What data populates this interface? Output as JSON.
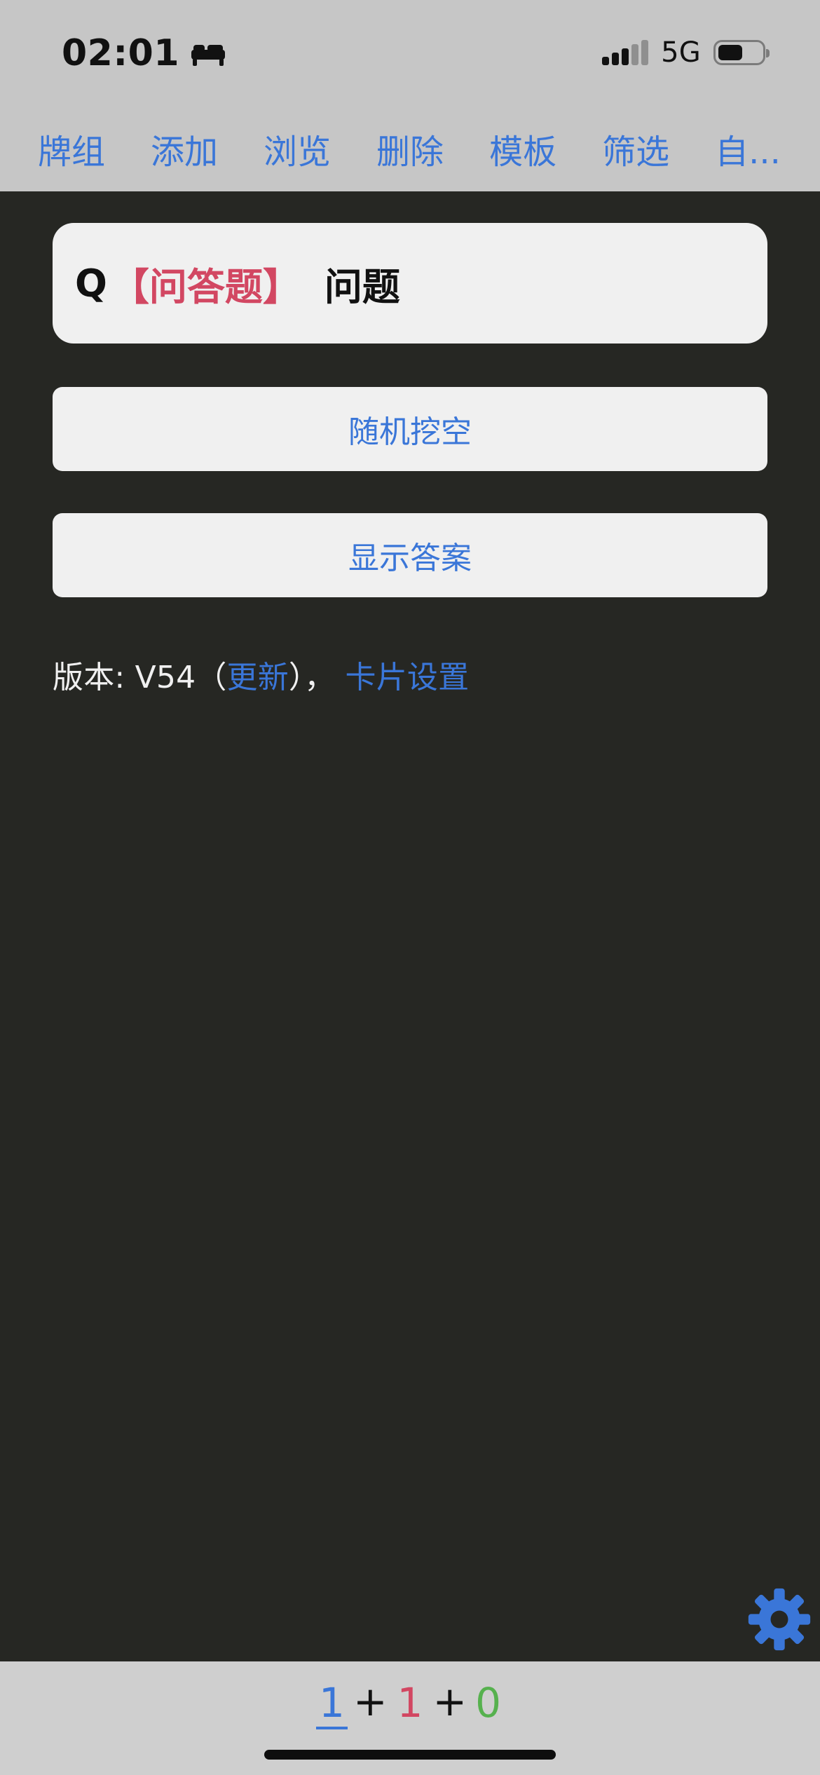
{
  "status_bar": {
    "time": "02:01",
    "sleep_icon": "bed-icon",
    "network": "5G",
    "signal_icon": "signal-icon",
    "battery_icon": "battery-icon",
    "battery_level_percent": 50
  },
  "toolbar": {
    "items": [
      {
        "label": "牌组"
      },
      {
        "label": "添加"
      },
      {
        "label": "浏览"
      },
      {
        "label": "删除"
      },
      {
        "label": "模板"
      },
      {
        "label": "筛选"
      },
      {
        "label": "自..."
      }
    ]
  },
  "card": {
    "question_prefix": "Q",
    "question_tag": "【问答题】",
    "question_text": "问题"
  },
  "buttons": {
    "random_cloze": "随机挖空",
    "show_answer": "显示答案"
  },
  "version": {
    "label": "版本: V54",
    "open_paren": "（",
    "update_link": "更新",
    "close_paren": "）",
    "separator": "，",
    "card_settings_link": "卡片设置"
  },
  "floating": {
    "settings_icon": "gear-icon"
  },
  "counts": {
    "new": "1",
    "learn": "1",
    "review": "0",
    "plus": "+"
  },
  "colors": {
    "accent_blue": "#3a76d8",
    "accent_red": "#d24762",
    "accent_green": "#56b14e",
    "app_background": "#262723",
    "toolbar_background": "#c6c6c6",
    "bottom_background": "#cfcfcf",
    "card_background": "#f0f0f0"
  }
}
